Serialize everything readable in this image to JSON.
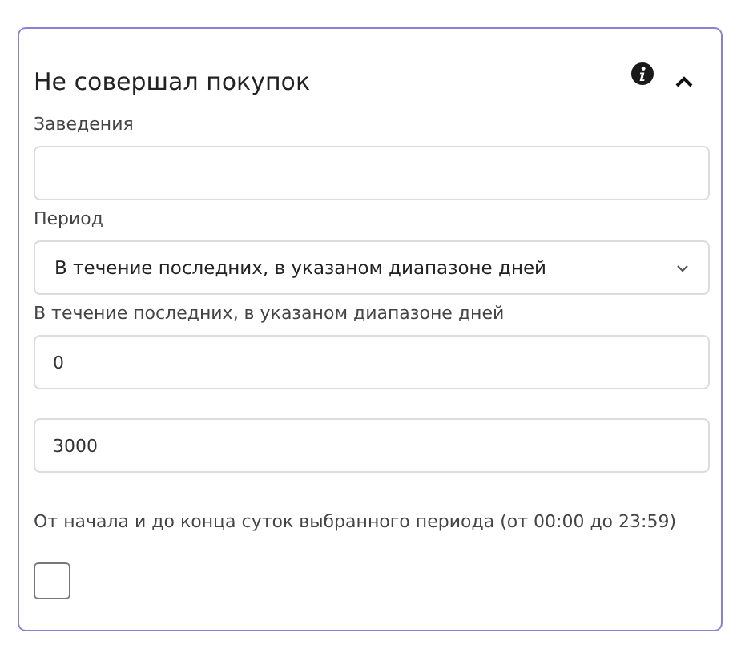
{
  "panel": {
    "title": "Не совершал покупок",
    "expanded": true
  },
  "fields": [
    {
      "kind": "input",
      "label": "Заведения"
    },
    {
      "kind": "select",
      "label": "Период",
      "value": "В течение последних, в указаном диапазоне дней"
    },
    {
      "kind": "input",
      "label": "В течение последних, в указаном диапазоне дней",
      "value": "0"
    },
    {
      "kind": "input",
      "value": "3000"
    },
    {
      "kind": "checkbox",
      "label": "От начала и до конца суток выбранного периода (от 00:00 до 23:59)",
      "checked": false
    }
  ]
}
